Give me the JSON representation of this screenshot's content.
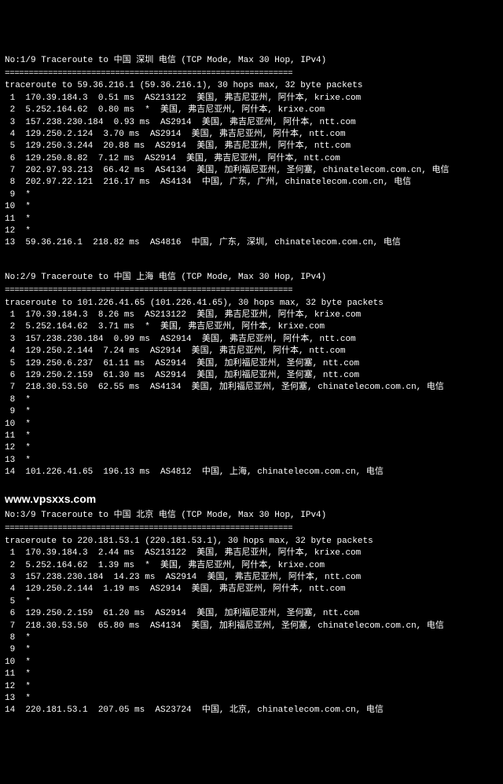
{
  "watermark": "www.vpsxxs.com",
  "sections": [
    {
      "header": "No:1/9 Traceroute to 中国 深圳 电信 (TCP Mode, Max 30 Hop, IPv4)",
      "divider": "============================================================",
      "traceroute_line": "traceroute to 59.36.216.1 (59.36.216.1), 30 hops max, 32 byte packets",
      "hops": [
        " 1  170.39.184.3  0.51 ms  AS213122  美国, 弗吉尼亚州, 阿什本, krixe.com",
        " 2  5.252.164.62  0.80 ms  *  美国, 弗吉尼亚州, 阿什本, krixe.com",
        " 3  157.238.230.184  0.93 ms  AS2914  美国, 弗吉尼亚州, 阿什本, ntt.com",
        " 4  129.250.2.124  3.70 ms  AS2914  美国, 弗吉尼亚州, 阿什本, ntt.com",
        " 5  129.250.3.244  20.88 ms  AS2914  美国, 弗吉尼亚州, 阿什本, ntt.com",
        " 6  129.250.8.82  7.12 ms  AS2914  美国, 弗吉尼亚州, 阿什本, ntt.com",
        " 7  202.97.93.213  66.42 ms  AS4134  美国, 加利福尼亚州, 圣何塞, chinatelecom.com.cn, 电信",
        " 8  202.97.22.121  216.17 ms  AS4134  中国, 广东, 广州, chinatelecom.com.cn, 电信",
        " 9  *",
        "10  *",
        "11  *",
        "12  *",
        "13  59.36.216.1  218.82 ms  AS4816  中国, 广东, 深圳, chinatelecom.com.cn, 电信"
      ]
    },
    {
      "header": "No:2/9 Traceroute to 中国 上海 电信 (TCP Mode, Max 30 Hop, IPv4)",
      "divider": "============================================================",
      "traceroute_line": "traceroute to 101.226.41.65 (101.226.41.65), 30 hops max, 32 byte packets",
      "hops": [
        " 1  170.39.184.3  8.26 ms  AS213122  美国, 弗吉尼亚州, 阿什本, krixe.com",
        " 2  5.252.164.62  3.71 ms  *  美国, 弗吉尼亚州, 阿什本, krixe.com",
        " 3  157.238.230.184  0.99 ms  AS2914  美国, 弗吉尼亚州, 阿什本, ntt.com",
        " 4  129.250.2.144  7.24 ms  AS2914  美国, 弗吉尼亚州, 阿什本, ntt.com",
        " 5  129.250.6.237  61.11 ms  AS2914  美国, 加利福尼亚州, 圣何塞, ntt.com",
        " 6  129.250.2.159  61.30 ms  AS2914  美国, 加利福尼亚州, 圣何塞, ntt.com",
        " 7  218.30.53.50  62.55 ms  AS4134  美国, 加利福尼亚州, 圣何塞, chinatelecom.com.cn, 电信",
        " 8  *",
        " 9  *",
        "10  *",
        "11  *",
        "12  *",
        "13  *",
        "14  101.226.41.65  196.13 ms  AS4812  中国, 上海, chinatelecom.com.cn, 电信"
      ]
    },
    {
      "header": "No:3/9 Traceroute to 中国 北京 电信 (TCP Mode, Max 30 Hop, IPv4)",
      "divider": "============================================================",
      "traceroute_line": "traceroute to 220.181.53.1 (220.181.53.1), 30 hops max, 32 byte packets",
      "hops": [
        " 1  170.39.184.3  2.44 ms  AS213122  美国, 弗吉尼亚州, 阿什本, krixe.com",
        " 2  5.252.164.62  1.39 ms  *  美国, 弗吉尼亚州, 阿什本, krixe.com",
        " 3  157.238.230.184  14.23 ms  AS2914  美国, 弗吉尼亚州, 阿什本, ntt.com",
        " 4  129.250.2.144  1.19 ms  AS2914  美国, 弗吉尼亚州, 阿什本, ntt.com",
        " 5  *",
        " 6  129.250.2.159  61.20 ms  AS2914  美国, 加利福尼亚州, 圣何塞, ntt.com",
        " 7  218.30.53.50  65.80 ms  AS4134  美国, 加利福尼亚州, 圣何塞, chinatelecom.com.cn, 电信",
        " 8  *",
        " 9  *",
        "10  *",
        "11  *",
        "12  *",
        "13  *",
        "14  220.181.53.1  207.05 ms  AS23724  中国, 北京, chinatelecom.com.cn, 电信"
      ]
    }
  ]
}
